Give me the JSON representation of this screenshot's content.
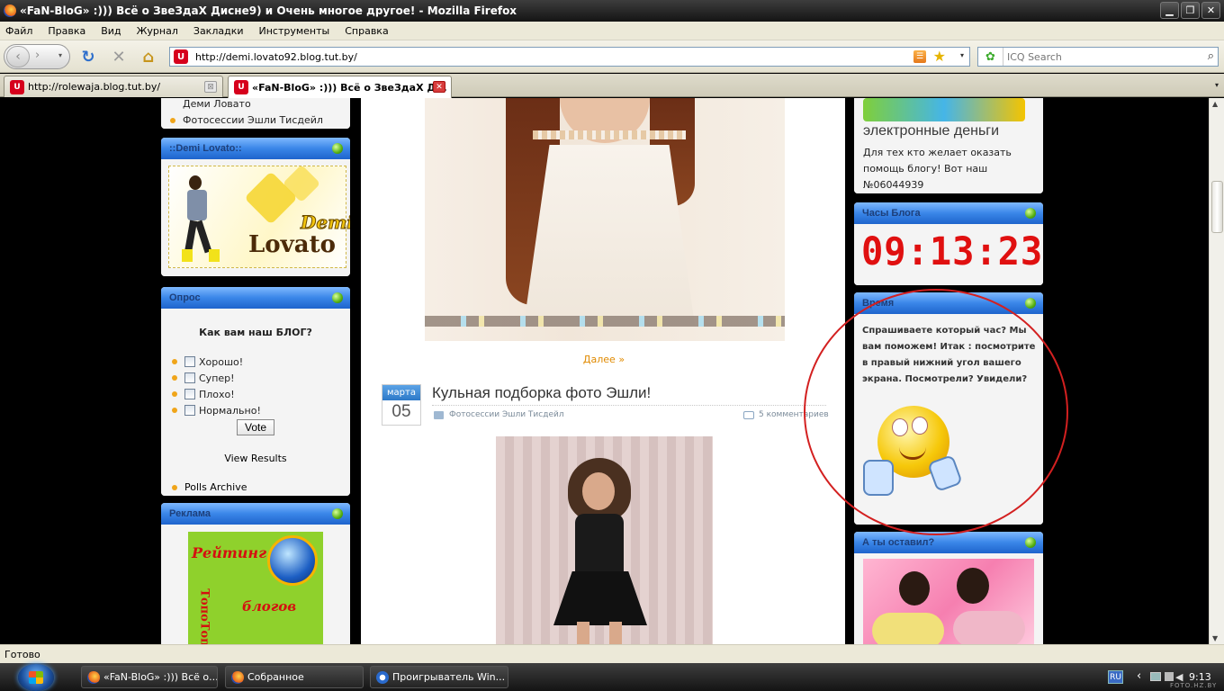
{
  "window": {
    "title": "«FaN-BloG» :))) Всё о ЗвеЗдаХ Дисне9) и Очень многое другое! - Mozilla Firefox",
    "minimize": "▁",
    "restore": "❐",
    "close": "✕"
  },
  "menu": [
    "Файл",
    "Правка",
    "Вид",
    "Журнал",
    "Закладки",
    "Инструменты",
    "Справка"
  ],
  "toolbar": {
    "back": "‹",
    "forward": "›",
    "history_dropdown": "▾",
    "reload": "↻",
    "stop": "✕",
    "home": "⌂"
  },
  "address": {
    "url": "http://demi.lovato92.blog.tut.by/",
    "rss": "☰",
    "bookmark": "★",
    "dropdown": "▾"
  },
  "search": {
    "engine": "✿",
    "placeholder": "ICQ Search",
    "go": "⌕"
  },
  "tabs": [
    {
      "label": "http://rolewaja.blog.tut.by/",
      "close": "⊠"
    },
    {
      "label": "«FaN-BloG» :))) Всё о ЗвеЗдаХ Д...",
      "close": "✕"
    }
  ],
  "tabs_list": "▾",
  "left_sidebar": {
    "top_links": [
      "Деми Ловато",
      "Фотосессии Эшли Тисдейл"
    ],
    "demi_widget": {
      "title": "::Demi Lovato::",
      "banner_word1": "Demi",
      "banner_word2": "Lovato"
    },
    "poll_widget": {
      "title": "Опрос",
      "question": "Как вам наш БЛОГ?",
      "options": [
        "Хорошо!",
        "Супер!",
        "Плохо!",
        "Нормально!"
      ],
      "vote": "Vote",
      "view_results": "View Results",
      "archive": "Polls Archive"
    },
    "ads_widget": {
      "title": "Реклама",
      "banner_top": "Рейтинг",
      "banner_middle": "блогов",
      "banner_side": "ТопоТоп"
    }
  },
  "content": {
    "more_link": "Далее »",
    "post": {
      "month": "марта",
      "day": "05",
      "title": "Кульная подборка фото Эшли!",
      "category": "Фотосессии Эшли Тисдейл",
      "comments": "5 комментариев"
    }
  },
  "right_sidebar": {
    "money_widget": {
      "logo_text": "электронные деньги",
      "body": [
        "Для тех кто желает оказать",
        "помощь блогу! Вот наш",
        "№06044939"
      ]
    },
    "clock_widget": {
      "title": "Часы Блога",
      "time": "09:13:23"
    },
    "time_widget": {
      "title": "Время",
      "body": [
        "Спрашиваете который час? Мы",
        "вам поможем! Итак : посмотрите",
        "в правый нижний угол вашего",
        "экрана. Посмотрели? Увидели?"
      ]
    },
    "left_widget": {
      "title": "А ты оставил?"
    }
  },
  "status": "Готово",
  "taskbar": {
    "tasks": [
      "«FaN-BloG» :))) Всё о...",
      "Собранное",
      "Проигрыватель Win..."
    ],
    "lang": "RU",
    "tray_arrow": "‹",
    "clock": "9:13",
    "watermark": "FOTO.HZ.BY"
  },
  "colors": {
    "widget_header": "#3a86e8",
    "clock_digits": "#e01010",
    "annotation_circle": "#d32020",
    "link_orange": "#e08a00"
  }
}
